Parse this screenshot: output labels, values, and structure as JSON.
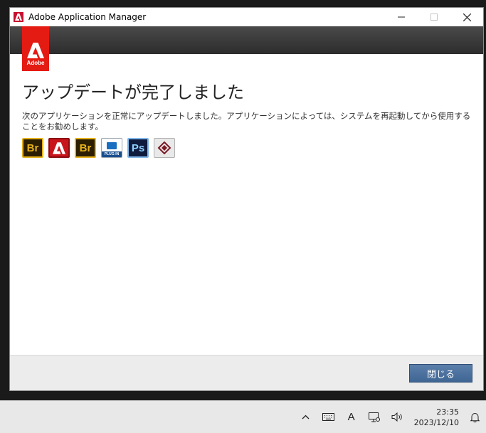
{
  "window": {
    "title": "Adobe Application Manager",
    "controls": {
      "minimize_icon": "minimize-icon",
      "maximize_icon": "maximize-icon",
      "close_icon": "close-icon"
    }
  },
  "banner": {
    "logo_word": "Adobe"
  },
  "main": {
    "heading": "アップデートが完了しました",
    "message": "次のアプリケーションを正常にアップデートしました。アプリケーションによっては、システムを再起動してから使用することをお勧めします。",
    "updated_apps": [
      {
        "name": "bridge-icon",
        "label": "Br"
      },
      {
        "name": "acrobat-icon",
        "label": ""
      },
      {
        "name": "bridge-icon",
        "label": "Br"
      },
      {
        "name": "plugin-icon",
        "label": "PLUG-IN"
      },
      {
        "name": "photoshop-icon",
        "label": "Ps"
      },
      {
        "name": "extension-manager-icon",
        "label": ""
      }
    ]
  },
  "footer": {
    "close_label": "閉じる"
  },
  "taskbar": {
    "tray_icons": [
      "chevron-up-icon",
      "keyboard-icon",
      "ime-icon",
      "network-icon",
      "volume-icon"
    ],
    "ime_label": "A",
    "time": "23:35",
    "date": "2023/12/10",
    "notification_icon": "bell-icon"
  },
  "colors": {
    "adobe_red": "#e41b13",
    "button_blue": "#4a6f9c",
    "banner_dark": "#333333"
  }
}
